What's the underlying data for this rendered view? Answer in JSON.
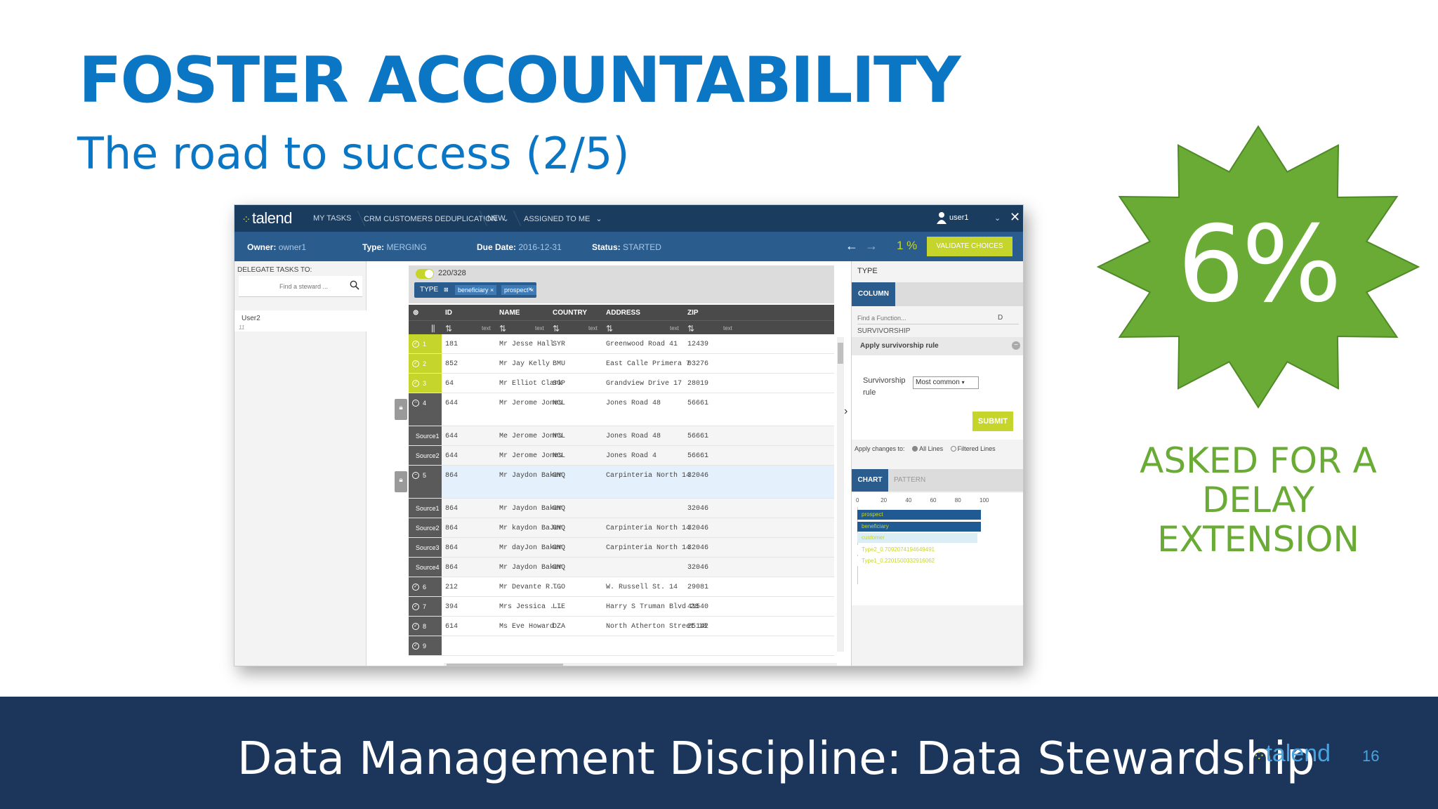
{
  "slide": {
    "title": "FOSTER ACCOUNTABILITY",
    "subtitle": "The road to success (2/5)",
    "badge_value": "6%",
    "badge_caption": [
      "ASKED FOR A",
      "DELAY",
      "EXTENSION"
    ],
    "footer_title": "Data Management Discipline: Data Stewardship",
    "footer_logo": "talend",
    "page_number": "16",
    "colors": {
      "title": "#0b76c3",
      "burst": "#6aab35",
      "footer": "#1c355b",
      "accent": "#c5d52c"
    }
  },
  "app": {
    "logo": "talend",
    "nav": [
      "MY TASKS",
      "CRM CUSTOMERS DEDUPLICATION",
      "NEW",
      "ASSIGNED TO ME"
    ],
    "user": "user1",
    "owner_label": "Owner:",
    "owner_value": "owner1",
    "type_label": "Type:",
    "type_value": "MERGING",
    "due_label": "Due Date:",
    "due_value": "2016-12-31",
    "status_label": "Status:",
    "status_value": "STARTED",
    "progress_text": "1 %",
    "validate_label": "VALIDATE CHOICES",
    "delegate_label": "DELEGATE TASKS TO:",
    "steward_placeholder": "Find a steward ...",
    "delegate_user": "User2",
    "delegate_count": "11",
    "record_count": "220/328",
    "filter": {
      "key": "TYPE",
      "chips": [
        "beneficiary",
        "prospect"
      ]
    },
    "columns": [
      "ID",
      "NAME",
      "COUNTRY",
      "ADDRESS",
      "ZIP"
    ],
    "column_type": "text",
    "rows": [
      {
        "kind": "grp",
        "label": "1",
        "id": "181",
        "name": "Mr Jesse Hall",
        "country": "SYR",
        "address": "Greenwood Road 41",
        "zip": "12439"
      },
      {
        "kind": "grp",
        "label": "2",
        "id": "852",
        "name": "Mr Jay Kelly",
        "country": "BMU",
        "address": "East Calle Primera 7",
        "zip": "03276"
      },
      {
        "kind": "grp",
        "label": "3",
        "id": "64",
        "name": "Mr Elliot Clark",
        "country": "SGP",
        "address": "Grandview Drive 17",
        "zip": "28019"
      },
      {
        "kind": "exp",
        "label": "4",
        "id": "644",
        "name": "Mr Jerome Jones",
        "country": "NCL",
        "address": "Jones Road 48",
        "zip": "56661"
      },
      {
        "kind": "src",
        "label": "Source1",
        "id": "644",
        "name": "Me Jerome Jonrs",
        "country": "NCL",
        "address": "Jones Road 48",
        "zip": "56661"
      },
      {
        "kind": "src",
        "label": "Source2",
        "id": "644",
        "name": "Mr Jerome Jones",
        "country": "NCL",
        "address": "Jones Road 4",
        "zip": "56661"
      },
      {
        "kind": "exp",
        "label": "5",
        "id": "864",
        "name": "Mr Jaydon Baker",
        "country": "GNQ",
        "address": "Carpinteria North 14",
        "zip": "32046"
      },
      {
        "kind": "src",
        "label": "Source1",
        "id": "864",
        "name": "Mr Jaydon Baker",
        "country": "GNQ",
        "address": "",
        "zip": "32046"
      },
      {
        "kind": "src",
        "label": "Source2",
        "id": "864",
        "name": "Mr kaydon BaJer",
        "country": "GNQ",
        "address": "Carpinteria North 14",
        "zip": "32046"
      },
      {
        "kind": "src",
        "label": "Source3",
        "id": "864",
        "name": "Mr dayJon Baker",
        "country": "GNQ",
        "address": "Carpinteria North 14",
        "zip": "32046"
      },
      {
        "kind": "src",
        "label": "Source4",
        "id": "864",
        "name": "Mr Jaydon Baker",
        "country": "GNQ",
        "address": "",
        "zip": "32046"
      },
      {
        "kind": "row",
        "label": "6",
        "id": "212",
        "name": "Mr Devante R...",
        "country": "TGO",
        "address": "W. Russell St. 14",
        "zip": "29081"
      },
      {
        "kind": "row",
        "label": "7",
        "id": "394",
        "name": "Mrs Jessica ...",
        "country": "LIE",
        "address": "Harry S Truman Blvd 28",
        "zip": "41540"
      },
      {
        "kind": "row",
        "label": "8",
        "id": "614",
        "name": "Ms Eve Howard",
        "country": "DZA",
        "address": "North Atherton Street 18",
        "zip": "25142"
      },
      {
        "kind": "row",
        "label": "9",
        "id": "",
        "name": "",
        "country": "",
        "address": "",
        "zip": ""
      }
    ],
    "right": {
      "type_label": "TYPE",
      "tab_column": "COLUMN",
      "find_placeholder": "Find a Function...",
      "d_label": "D",
      "survivorship_label": "SURVIVORSHIP",
      "apply_rule_label": "Apply survivorship rule",
      "collapse_symbol": "−",
      "rule_label": "Survivorship rule",
      "rule_value": "Most common",
      "submit_label": "SUBMIT",
      "apply_changes_label": "Apply changes to:",
      "opt_all": "All Lines",
      "opt_filtered": "Filtered Lines",
      "tab_chart": "CHART",
      "tab_pattern": "PATTERN",
      "ticks": [
        "0",
        "20",
        "40",
        "60",
        "80",
        "100"
      ],
      "bars": [
        {
          "label": "prospect",
          "value": 100,
          "color": "#1f5a93",
          "text": "#c5d52c"
        },
        {
          "label": "beneficiary",
          "value": 100,
          "color": "#1f5a93",
          "text": "#c5d52c"
        },
        {
          "label": "customer",
          "value": 97,
          "color": "#dbeef5",
          "text": "#c5d52c"
        },
        {
          "label": "Type2_0.7092074194649491",
          "value": 0.5,
          "color": "#ffffff",
          "text": "#c5d52c"
        },
        {
          "label": "Type1_0.2201500332916062",
          "value": 0.5,
          "color": "#ffffff",
          "text": "#c5d52c"
        }
      ]
    }
  }
}
